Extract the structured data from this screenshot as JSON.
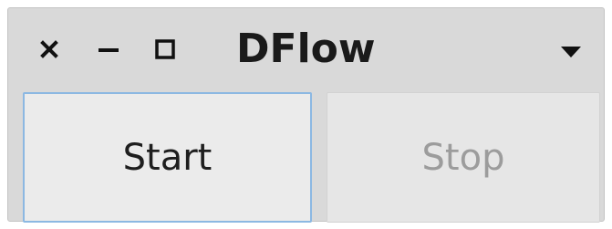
{
  "window": {
    "title": "DFlow"
  },
  "titlebar": {
    "close_icon": "close-icon",
    "minimize_icon": "minimize-icon",
    "maximize_icon": "maximize-icon",
    "menu_icon": "dropdown-arrow-icon"
  },
  "buttons": {
    "start_label": "Start",
    "stop_label": "Stop",
    "stop_enabled": false
  },
  "colors": {
    "window_bg": "#d9d9d9",
    "focus_border": "#8cb8e2",
    "disabled_text": "#9c9c9c"
  }
}
